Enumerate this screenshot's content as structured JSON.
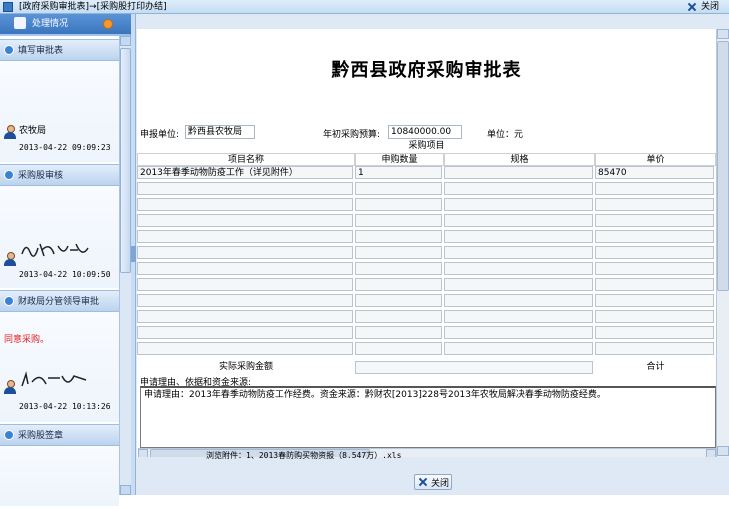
{
  "window": {
    "title": "[政府采购审批表]→[采购股打印办结]",
    "close_label": "关闭"
  },
  "sidebar": {
    "header": "处理情况",
    "sections": [
      {
        "title": "填写审批表",
        "signer": "农牧局",
        "time": "2013-04-22 09:09:23"
      },
      {
        "title": "采购股审核",
        "signer": "",
        "time": "2013-04-22 10:09:50"
      },
      {
        "title": "财政局分管领导审批",
        "comment": "同意采购。",
        "time": "2013-04-22 10:13:26"
      },
      {
        "title": "采购股签章"
      }
    ]
  },
  "form": {
    "title": "黔西县政府采购审批表",
    "unit_label": "申报单位:",
    "unit_value": "黔西县农牧局",
    "budget_label": "年初采购预算:",
    "budget_value": "10840000.00",
    "currency_label": "单位：元",
    "section_header": "采购项目",
    "columns": [
      "项目名称",
      "申购数量",
      "规格",
      "单价"
    ],
    "rows": [
      [
        "2013年春季动物防疫工作（详见附件）",
        "1",
        "",
        "85470"
      ],
      [
        "",
        "",
        "",
        ""
      ],
      [
        "",
        "",
        "",
        ""
      ],
      [
        "",
        "",
        "",
        ""
      ],
      [
        "",
        "",
        "",
        ""
      ],
      [
        "",
        "",
        "",
        ""
      ],
      [
        "",
        "",
        "",
        ""
      ],
      [
        "",
        "",
        "",
        ""
      ],
      [
        "",
        "",
        "",
        ""
      ],
      [
        "",
        "",
        "",
        ""
      ],
      [
        "",
        "",
        "",
        ""
      ],
      [
        "",
        "",
        "",
        ""
      ]
    ],
    "actual_amount_label": "实际采购金额",
    "total_label": "合计",
    "reason_label": "申请理由、依据和资金来源:",
    "reason_text": "申请理由：2013年春季动物防疫工作经费。资金来源：黔财农[2013]228号2013年农牧局解决春季动物防疫经费。",
    "attachment_prefix": "浏览附件：",
    "attachment_file": "1、2013春防购买物资报（8.547万）.xls"
  },
  "footer": {
    "close_label": "关闭"
  }
}
